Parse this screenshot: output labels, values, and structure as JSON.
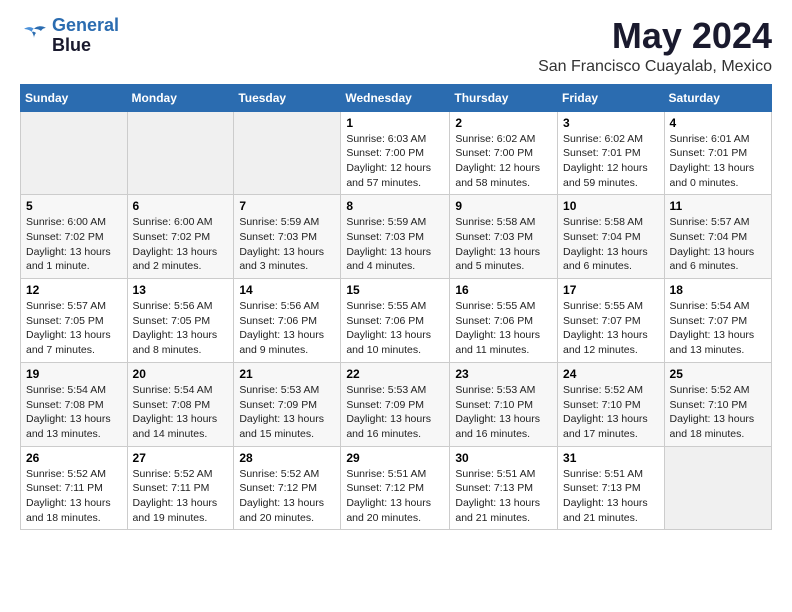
{
  "logo": {
    "line1": "General",
    "line2": "Blue"
  },
  "title": "May 2024",
  "location": "San Francisco Cuayalab, Mexico",
  "weekdays": [
    "Sunday",
    "Monday",
    "Tuesday",
    "Wednesday",
    "Thursday",
    "Friday",
    "Saturday"
  ],
  "weeks": [
    [
      {
        "day": "",
        "info": ""
      },
      {
        "day": "",
        "info": ""
      },
      {
        "day": "",
        "info": ""
      },
      {
        "day": "1",
        "info": "Sunrise: 6:03 AM\nSunset: 7:00 PM\nDaylight: 12 hours\nand 57 minutes."
      },
      {
        "day": "2",
        "info": "Sunrise: 6:02 AM\nSunset: 7:00 PM\nDaylight: 12 hours\nand 58 minutes."
      },
      {
        "day": "3",
        "info": "Sunrise: 6:02 AM\nSunset: 7:01 PM\nDaylight: 12 hours\nand 59 minutes."
      },
      {
        "day": "4",
        "info": "Sunrise: 6:01 AM\nSunset: 7:01 PM\nDaylight: 13 hours\nand 0 minutes."
      }
    ],
    [
      {
        "day": "5",
        "info": "Sunrise: 6:00 AM\nSunset: 7:02 PM\nDaylight: 13 hours\nand 1 minute."
      },
      {
        "day": "6",
        "info": "Sunrise: 6:00 AM\nSunset: 7:02 PM\nDaylight: 13 hours\nand 2 minutes."
      },
      {
        "day": "7",
        "info": "Sunrise: 5:59 AM\nSunset: 7:03 PM\nDaylight: 13 hours\nand 3 minutes."
      },
      {
        "day": "8",
        "info": "Sunrise: 5:59 AM\nSunset: 7:03 PM\nDaylight: 13 hours\nand 4 minutes."
      },
      {
        "day": "9",
        "info": "Sunrise: 5:58 AM\nSunset: 7:03 PM\nDaylight: 13 hours\nand 5 minutes."
      },
      {
        "day": "10",
        "info": "Sunrise: 5:58 AM\nSunset: 7:04 PM\nDaylight: 13 hours\nand 6 minutes."
      },
      {
        "day": "11",
        "info": "Sunrise: 5:57 AM\nSunset: 7:04 PM\nDaylight: 13 hours\nand 6 minutes."
      }
    ],
    [
      {
        "day": "12",
        "info": "Sunrise: 5:57 AM\nSunset: 7:05 PM\nDaylight: 13 hours\nand 7 minutes."
      },
      {
        "day": "13",
        "info": "Sunrise: 5:56 AM\nSunset: 7:05 PM\nDaylight: 13 hours\nand 8 minutes."
      },
      {
        "day": "14",
        "info": "Sunrise: 5:56 AM\nSunset: 7:06 PM\nDaylight: 13 hours\nand 9 minutes."
      },
      {
        "day": "15",
        "info": "Sunrise: 5:55 AM\nSunset: 7:06 PM\nDaylight: 13 hours\nand 10 minutes."
      },
      {
        "day": "16",
        "info": "Sunrise: 5:55 AM\nSunset: 7:06 PM\nDaylight: 13 hours\nand 11 minutes."
      },
      {
        "day": "17",
        "info": "Sunrise: 5:55 AM\nSunset: 7:07 PM\nDaylight: 13 hours\nand 12 minutes."
      },
      {
        "day": "18",
        "info": "Sunrise: 5:54 AM\nSunset: 7:07 PM\nDaylight: 13 hours\nand 13 minutes."
      }
    ],
    [
      {
        "day": "19",
        "info": "Sunrise: 5:54 AM\nSunset: 7:08 PM\nDaylight: 13 hours\nand 13 minutes."
      },
      {
        "day": "20",
        "info": "Sunrise: 5:54 AM\nSunset: 7:08 PM\nDaylight: 13 hours\nand 14 minutes."
      },
      {
        "day": "21",
        "info": "Sunrise: 5:53 AM\nSunset: 7:09 PM\nDaylight: 13 hours\nand 15 minutes."
      },
      {
        "day": "22",
        "info": "Sunrise: 5:53 AM\nSunset: 7:09 PM\nDaylight: 13 hours\nand 16 minutes."
      },
      {
        "day": "23",
        "info": "Sunrise: 5:53 AM\nSunset: 7:10 PM\nDaylight: 13 hours\nand 16 minutes."
      },
      {
        "day": "24",
        "info": "Sunrise: 5:52 AM\nSunset: 7:10 PM\nDaylight: 13 hours\nand 17 minutes."
      },
      {
        "day": "25",
        "info": "Sunrise: 5:52 AM\nSunset: 7:10 PM\nDaylight: 13 hours\nand 18 minutes."
      }
    ],
    [
      {
        "day": "26",
        "info": "Sunrise: 5:52 AM\nSunset: 7:11 PM\nDaylight: 13 hours\nand 18 minutes."
      },
      {
        "day": "27",
        "info": "Sunrise: 5:52 AM\nSunset: 7:11 PM\nDaylight: 13 hours\nand 19 minutes."
      },
      {
        "day": "28",
        "info": "Sunrise: 5:52 AM\nSunset: 7:12 PM\nDaylight: 13 hours\nand 20 minutes."
      },
      {
        "day": "29",
        "info": "Sunrise: 5:51 AM\nSunset: 7:12 PM\nDaylight: 13 hours\nand 20 minutes."
      },
      {
        "day": "30",
        "info": "Sunrise: 5:51 AM\nSunset: 7:13 PM\nDaylight: 13 hours\nand 21 minutes."
      },
      {
        "day": "31",
        "info": "Sunrise: 5:51 AM\nSunset: 7:13 PM\nDaylight: 13 hours\nand 21 minutes."
      },
      {
        "day": "",
        "info": ""
      }
    ]
  ]
}
